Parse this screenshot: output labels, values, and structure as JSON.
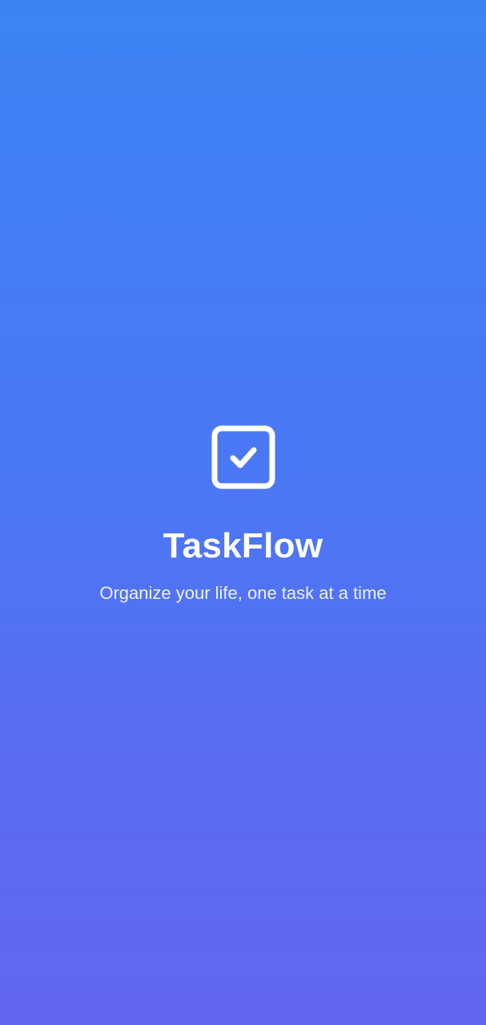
{
  "splash": {
    "app_name": "TaskFlow",
    "tagline": "Organize your life, one task at a time",
    "logo_icon": "checkbox-checked-icon"
  },
  "colors": {
    "gradient_top": "#3c84f6",
    "gradient_bottom": "#6366f1",
    "foreground": "#ffffff"
  }
}
